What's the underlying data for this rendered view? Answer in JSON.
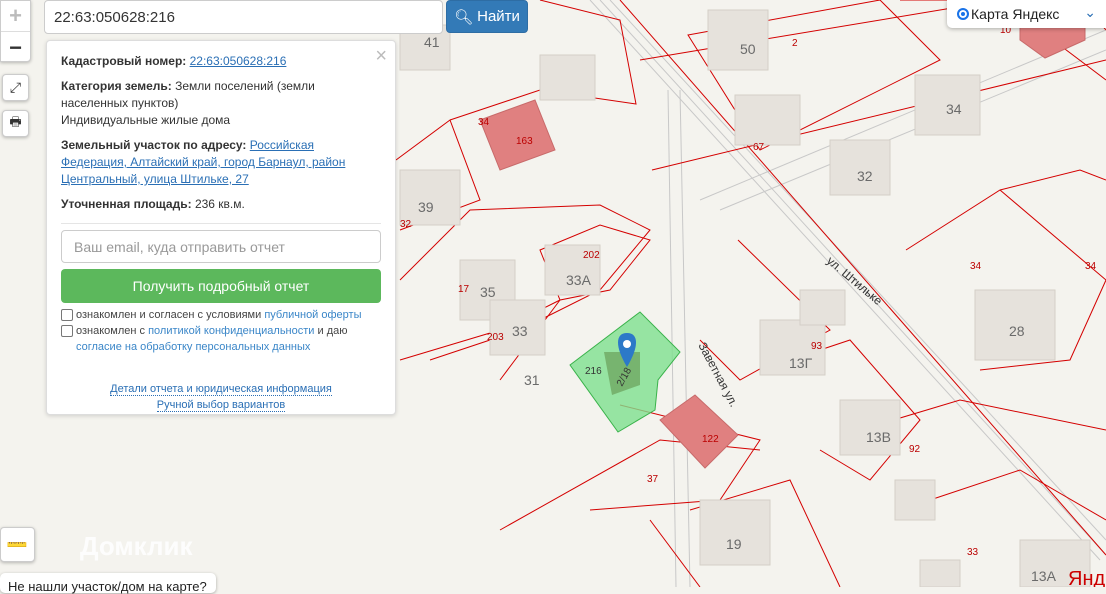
{
  "search": {
    "value": "22:63:050628:216",
    "button": "Найти"
  },
  "zoom": {
    "in": "+",
    "out": "−"
  },
  "panel": {
    "cad_label": "Кадастровый номер:",
    "cad_value": "22:63:050628:216",
    "cat_label": "Категория земель:",
    "cat_value": "Земли поселений (земли населенных пунктов)",
    "use": "Индивидуальные жилые дома",
    "addr_label": "Земельный участок по адресу:",
    "addr_value": "Российская Федерация, Алтайский край, город Барнаул, район Центральный, улица Штильке, 27",
    "area_label": "Уточненная площадь:",
    "area_value": "236 кв.м.",
    "email_placeholder": "Ваш email, куда отправить отчет",
    "get_button": "Получить подробный отчет",
    "chk1_text": "ознакомлен и согласен с условиями ",
    "chk1_link": "публичной оферты",
    "chk2_text": "ознакомлен с ",
    "chk2_link": "политикой конфиденциальности",
    "chk2_text2": " и даю ",
    "chk2_link2": "согласие на обработку персональных данных",
    "link_details": "Детали отчета и юридическая информация",
    "link_manual": "Ручной выбор вариантов",
    "close": "×"
  },
  "layer": {
    "selected": "Карта Яндекс"
  },
  "watermark": "Домклик",
  "not_found": "Не нашли участок/дом на карте?",
  "yandex": "Янде",
  "map": {
    "labels": [
      "41",
      "50",
      "34",
      "163",
      "39",
      "33А",
      "35",
      "33",
      "31",
      "13Г",
      "13В",
      "28",
      "19",
      "13А",
      "32"
    ],
    "red_labels": [
      "2",
      "67",
      "34",
      "32",
      "202",
      "17",
      "203",
      "216",
      "2/18",
      "93",
      "122",
      "37",
      "92",
      "34",
      "34",
      "33",
      "10"
    ],
    "streets": [
      "Заветная ул.",
      "ул. Штильке"
    ]
  },
  "colors": {
    "parcel": "#d40000",
    "selected_parcel": "#7ee08e",
    "button": "#337ab7",
    "green": "#5cb85c"
  }
}
